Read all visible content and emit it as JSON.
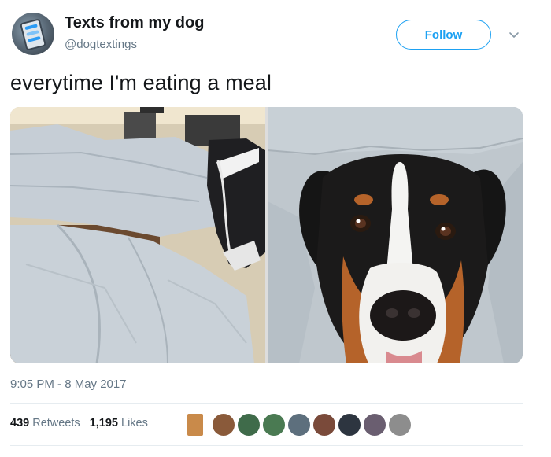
{
  "header": {
    "display_name": "Texts from my dog",
    "handle": "@dogtextings",
    "follow_label": "Follow",
    "avatar_icon": "dog-texting-avatar-icon",
    "menu_icon": "chevron-down-icon"
  },
  "tweet": {
    "text": "everytime I'm eating a meal",
    "media": [
      {
        "description_icon": "legs-on-lap-photo"
      },
      {
        "description_icon": "dog-face-photo"
      }
    ]
  },
  "meta": {
    "timestamp": "9:05 PM - 8 May 2017",
    "retweets_count": "439",
    "retweets_label": "Retweets",
    "likes_count": "1,195",
    "likes_label": "Likes"
  },
  "likers": {
    "count_shown": 9,
    "colors": [
      "#c98a4a",
      "#8a5a3a",
      "#3f6b4a",
      "#4a7a52",
      "#5d6f7d",
      "#7a4a3a",
      "#2d3540",
      "#6a5e70",
      "#8d8d8d"
    ]
  },
  "colors": {
    "accent": "#1da1f2",
    "text_primary": "#14171a",
    "text_secondary": "#657786"
  }
}
